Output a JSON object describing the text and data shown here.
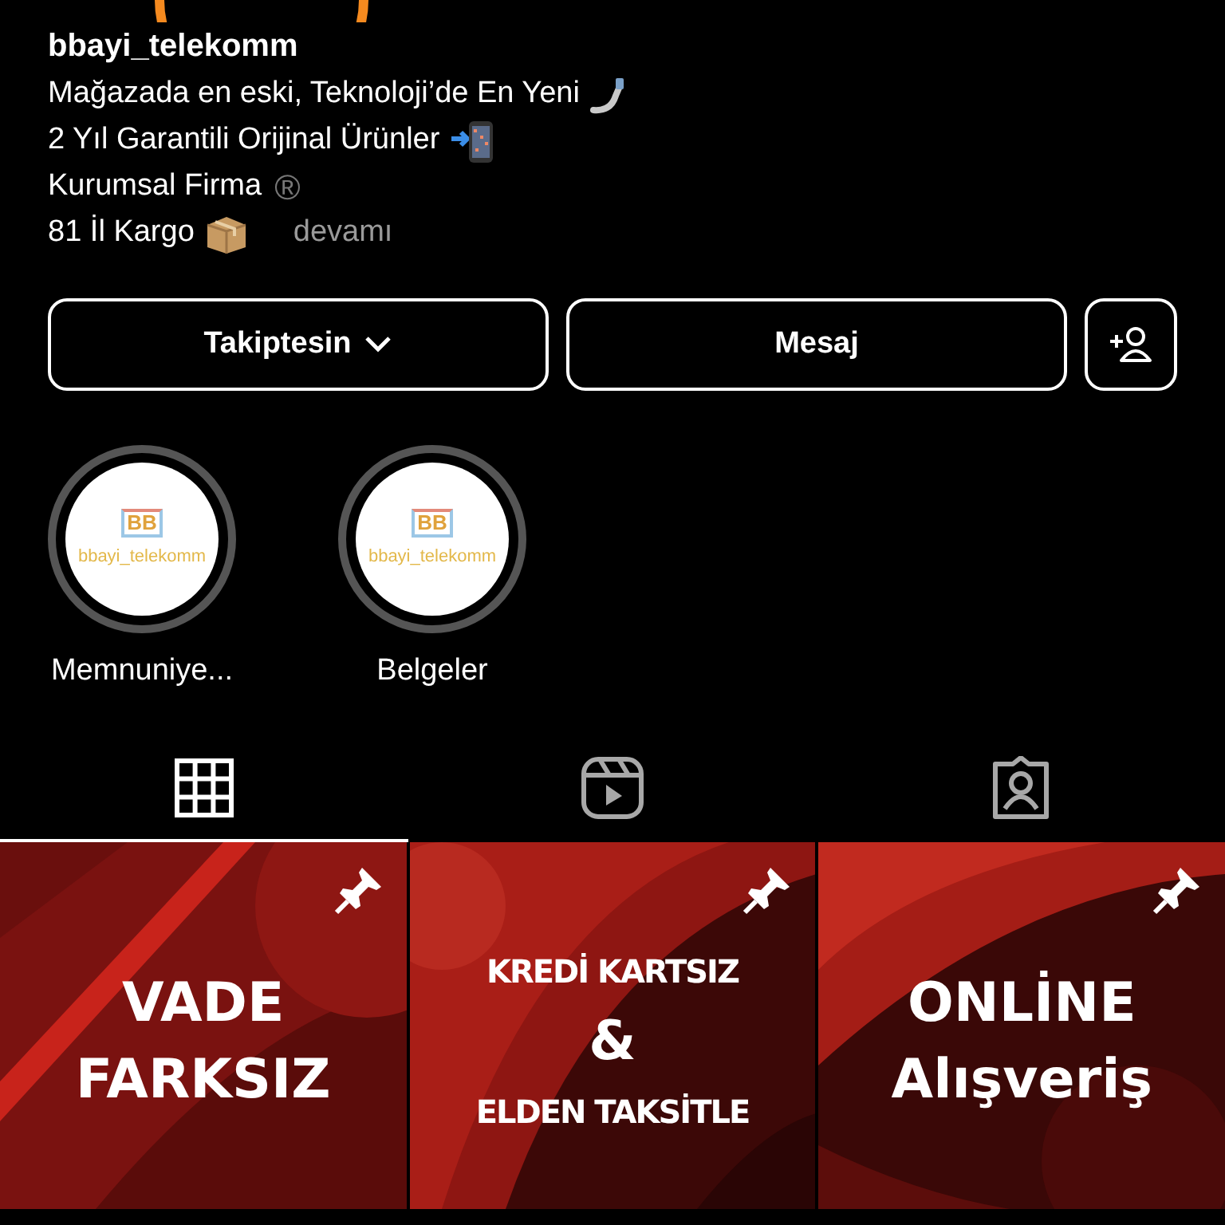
{
  "profile": {
    "username": "bbayi_telekomm",
    "bio": [
      {
        "text": "Mağazada en eski, Teknoloji’de En Yeni",
        "kind": "selfie"
      },
      {
        "text": "2 Yıl Garantili Orijinal Ürünler",
        "kind": "phone"
      },
      {
        "text": "Kurumsal Firma",
        "mark": "®"
      },
      {
        "text": "81 İl Kargo",
        "kind": "package"
      }
    ],
    "more_link": "devamı"
  },
  "buttons": [
    {
      "kind": "dropdown",
      "label": "Takiptesin"
    },
    {
      "kind": "plain",
      "label": "Mesaj"
    },
    {
      "kind": "add_person"
    }
  ],
  "highlights": [
    {
      "label": "Memnuniye...",
      "logo_letters": "BB",
      "cover_text": "bbayi_telekomm"
    },
    {
      "label": "Belgeler",
      "logo_letters": "BB",
      "cover_text": "bbayi_telekomm"
    }
  ],
  "tabs": [
    {
      "kind": "grid",
      "selected": true
    },
    {
      "kind": "reels",
      "selected": false
    },
    {
      "kind": "tagged",
      "selected": false
    }
  ],
  "posts": [
    {
      "pinned": true,
      "lines": [
        "VADE",
        "FARKSIZ"
      ]
    },
    {
      "pinned": true,
      "lines": [
        "KREDİ KARTSIZ",
        "&",
        "ELDEN TAKSİTLE"
      ]
    },
    {
      "pinned": true,
      "lines": [
        "ONLİNE",
        "Alışveriş"
      ]
    }
  ]
}
